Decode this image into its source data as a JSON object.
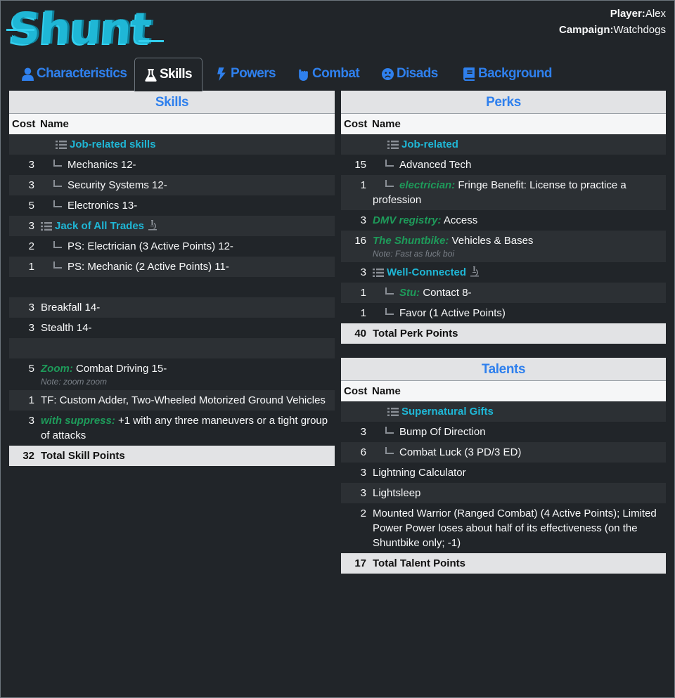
{
  "header": {
    "logo": "Shunt",
    "player_label": "Player:",
    "player": "Alex",
    "campaign_label": "Campaign:",
    "campaign": "Watchdogs"
  },
  "tabs": [
    {
      "label": "Characteristics",
      "icon": "user-icon"
    },
    {
      "label": "Skills",
      "icon": "flask-icon",
      "active": true
    },
    {
      "label": "Powers",
      "icon": "bolt-icon"
    },
    {
      "label": "Combat",
      "icon": "fist-icon"
    },
    {
      "label": "Disads",
      "icon": "sad-face-icon"
    },
    {
      "label": "Background",
      "icon": "book-icon"
    }
  ],
  "skills": {
    "title": "Skills",
    "col_cost": "Cost",
    "col_name": "Name",
    "rows": [
      {
        "cost": "",
        "name": "Job-related skills",
        "type": "group"
      },
      {
        "cost": "3",
        "name": "Mechanics 12-",
        "type": "child"
      },
      {
        "cost": "3",
        "name": "Security Systems 12-",
        "type": "child"
      },
      {
        "cost": "5",
        "name": "Electronics 13-",
        "type": "child"
      },
      {
        "cost": "3",
        "name": "Jack of All Trades",
        "type": "group-mic"
      },
      {
        "cost": "2",
        "name": "PS: Electrician (3 Active Points) 12-",
        "type": "child"
      },
      {
        "cost": "1",
        "name": "PS: Mechanic (2 Active Points) 11-",
        "type": "child"
      },
      {
        "cost": "",
        "name": "",
        "type": "blank"
      },
      {
        "cost": "3",
        "name": "Breakfall 14-",
        "type": "plain"
      },
      {
        "cost": "3",
        "name": "Stealth 14-",
        "type": "plain"
      },
      {
        "cost": "",
        "name": "",
        "type": "blank"
      },
      {
        "cost": "5",
        "prefix": "Zoom:",
        "name": "Combat Driving 15-",
        "note": "Note: zoom zoom",
        "type": "prefixed"
      },
      {
        "cost": "1",
        "name": "TF: Custom Adder, Two-Wheeled Motorized Ground Vehicles",
        "type": "plain"
      },
      {
        "cost": "3",
        "prefix": "with suppress:",
        "name": "+1 with any three maneuvers or a tight group of attacks",
        "type": "prefixed"
      }
    ],
    "total_cost": "32",
    "total_label": "Total Skill Points"
  },
  "perks": {
    "title": "Perks",
    "col_cost": "Cost",
    "col_name": "Name",
    "rows": [
      {
        "cost": "",
        "name": "Job-related",
        "type": "group"
      },
      {
        "cost": "15",
        "name": "Advanced Tech",
        "type": "child"
      },
      {
        "cost": "1",
        "prefix": "electrician:",
        "name": "Fringe Benefit: License to practice a profession",
        "type": "child-prefixed"
      },
      {
        "cost": "3",
        "prefix": "DMV registry:",
        "name": "Access",
        "type": "prefixed"
      },
      {
        "cost": "16",
        "prefix": "The Shuntbike:",
        "name": "Vehicles & Bases",
        "note": "Note: Fast as fuck boi",
        "type": "prefixed"
      },
      {
        "cost": "3",
        "name": "Well-Connected",
        "type": "group-mic"
      },
      {
        "cost": "1",
        "prefix": "Stu:",
        "name": "Contact 8-",
        "type": "child-prefixed"
      },
      {
        "cost": "1",
        "name": "Favor (1 Active Points)",
        "type": "child"
      }
    ],
    "total_cost": "40",
    "total_label": "Total Perk Points"
  },
  "talents": {
    "title": "Talents",
    "col_cost": "Cost",
    "col_name": "Name",
    "rows": [
      {
        "cost": "",
        "name": "Supernatural Gifts",
        "type": "group"
      },
      {
        "cost": "3",
        "name": "Bump Of Direction",
        "type": "child"
      },
      {
        "cost": "6",
        "name": "Combat Luck (3 PD/3 ED)",
        "type": "child"
      },
      {
        "cost": "3",
        "name": "Lightning Calculator",
        "type": "plain"
      },
      {
        "cost": "3",
        "name": "Lightsleep",
        "type": "plain"
      },
      {
        "cost": "2",
        "name": "Mounted Warrior (Ranged Combat) (4 Active Points); Limited Power Power loses about half of its effectiveness (on the Shuntbike only; -1)",
        "type": "plain"
      }
    ],
    "total_cost": "17",
    "total_label": "Total Talent Points"
  },
  "colors": {
    "background": "#212529",
    "accent_blue": "#2f80ed",
    "group_cyan": "#1fb7d6",
    "prefix_green": "#1e9b5a",
    "header_gray": "#e2e3e5"
  }
}
